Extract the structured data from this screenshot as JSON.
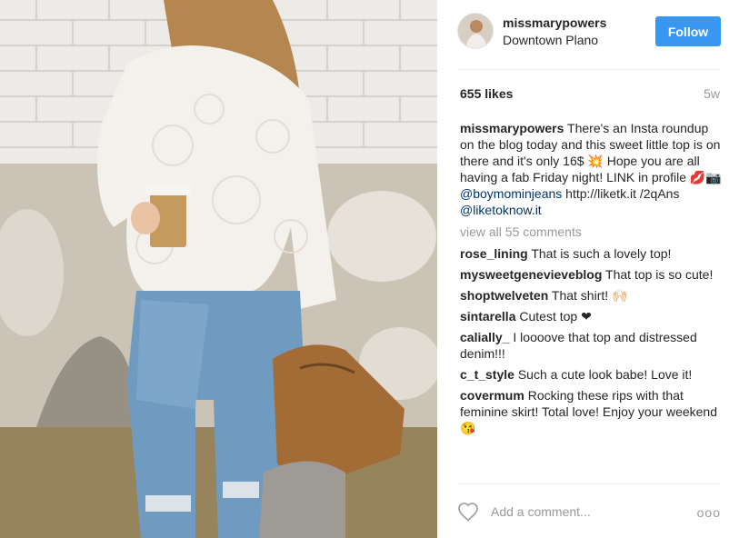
{
  "post": {
    "username": "missmarypowers",
    "location": "Downtown Plano",
    "follow_label": "Follow",
    "likes": "655 likes",
    "age": "5w"
  },
  "caption": {
    "user": "missmarypowers",
    "text_1": "There's an Insta roundup on the blog today and this sweet little top is on there and it's only 16$ 💥 Hope you are all having a fab Friday night! LINK in profile 💋📷",
    "mention_1": "@boymominjeans",
    "text_2": "http://liketk.it /2qAns",
    "mention_2": "@liketoknow.it"
  },
  "view_all": "view all 55 comments",
  "comments": [
    {
      "user": "rose_lining",
      "text": "That is such a lovely top!"
    },
    {
      "user": "mysweetgenevieveblog",
      "text": "That top is so cute!"
    },
    {
      "user": "shoptwelveten",
      "text": "That shirt! 🙌🏻"
    },
    {
      "user": "sintarella",
      "text": "Cutest top ❤"
    },
    {
      "user": "calially_",
      "text": "I loooove that top and distressed denim!!!"
    },
    {
      "user": "c_t_style",
      "text": "Such a cute look babe! Love it!"
    },
    {
      "user": "covermum",
      "text": "Rocking these rips with that feminine skirt! Total love! Enjoy your weekend 😘"
    }
  ],
  "footer": {
    "add_comment_placeholder": "Add a comment...",
    "more_glyph": "ooo"
  },
  "colors": {
    "follow_bg": "#3897f0",
    "link": "#003569",
    "muted": "#999999"
  },
  "icons": {
    "like": "heart-outline-icon",
    "more": "more-options-icon"
  }
}
